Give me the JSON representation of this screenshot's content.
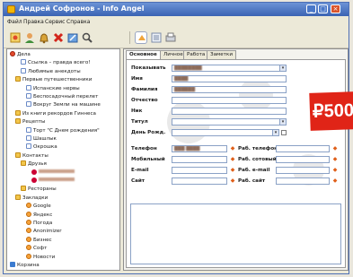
{
  "window": {
    "title": "Андрей Софронов - Info Angel",
    "minimize": "_",
    "maximize": "□",
    "close": "×"
  },
  "menu": [
    "Файл",
    "Правка",
    "Сервис",
    "Справка"
  ],
  "toolbar": {
    "icons": [
      "new-icon",
      "contact-icon",
      "bell-icon",
      "delete-icon",
      "edit-icon",
      "search-icon",
      "view-icon",
      "list-icon",
      "print-icon"
    ]
  },
  "tree": [
    {
      "label": "Дела",
      "icon": "root",
      "indent": 0
    },
    {
      "label": "Ссылка – правда всего!",
      "icon": "note",
      "indent": 2
    },
    {
      "label": "Любимые анекдоты",
      "icon": "note",
      "indent": 2
    },
    {
      "label": "Первые путешественники",
      "icon": "folder",
      "indent": 1
    },
    {
      "label": "Испанские нервы",
      "icon": "note",
      "indent": 3
    },
    {
      "label": "Беспосадочный перелет",
      "icon": "note",
      "indent": 3
    },
    {
      "label": "Вокруг Земли на машине",
      "icon": "note",
      "indent": 3
    },
    {
      "label": "Из книги рекордов Гиннеса",
      "icon": "folder",
      "indent": 1
    },
    {
      "label": "Рецепты",
      "icon": "folder",
      "indent": 1
    },
    {
      "label": "Торт \"С Днем рождения\"",
      "icon": "note",
      "indent": 3
    },
    {
      "label": "Шашлык",
      "icon": "note",
      "indent": 3
    },
    {
      "label": "Окрошка",
      "icon": "note",
      "indent": 3
    },
    {
      "label": "Контакты",
      "icon": "folder",
      "indent": 1
    },
    {
      "label": "Друзья",
      "icon": "folder",
      "indent": 2
    },
    {
      "label": "",
      "icon": "person",
      "indent": 4,
      "blurred": true
    },
    {
      "label": "",
      "icon": "person",
      "indent": 4,
      "blurred": true
    },
    {
      "label": "Рестораны",
      "icon": "folder",
      "indent": 2
    },
    {
      "label": "Закладки",
      "icon": "folder",
      "indent": 1
    },
    {
      "label": "Google",
      "icon": "globe",
      "indent": 3
    },
    {
      "label": "Яндекс",
      "icon": "globe",
      "indent": 3
    },
    {
      "label": "Погода",
      "icon": "globe",
      "indent": 3
    },
    {
      "label": "Anonimizer",
      "icon": "globe",
      "indent": 3
    },
    {
      "label": "Бизнес",
      "icon": "globe",
      "indent": 3
    },
    {
      "label": "Софт",
      "icon": "globe",
      "indent": 3
    },
    {
      "label": "Новости",
      "icon": "globe",
      "indent": 3
    },
    {
      "label": "Корзина",
      "icon": "trash",
      "indent": 0
    }
  ],
  "tabs": [
    "Основное",
    "Личное",
    "Работа",
    "Заметки"
  ],
  "form": {
    "show_label": "Показывать",
    "name_label": "Имя",
    "surname_label": "Фамилия",
    "patronymic_label": "Отчество",
    "nick_label": "Ник",
    "title_label": "Титул",
    "birthday_label": "День Рожд.",
    "phone_label": "Телефон",
    "mobile_label": "Мобильный",
    "email_label": "E-mail",
    "site_label": "Сайт",
    "work_phone_label": "Раб. телефон",
    "work_mobile_label": "Раб. сотовый",
    "work_email_label": "Раб. e-mail",
    "work_site_label": "Раб. сайт",
    "show_value": "████████",
    "name_value": "████",
    "surname_value": "██████",
    "phone_value": "███ ████"
  },
  "price_sticker": "₽500",
  "colors": {
    "title_bar": "#3a63b3",
    "price_sticker": "#e02417",
    "tree_folder": "#f2c64b",
    "field_border": "#8aa1c6"
  }
}
